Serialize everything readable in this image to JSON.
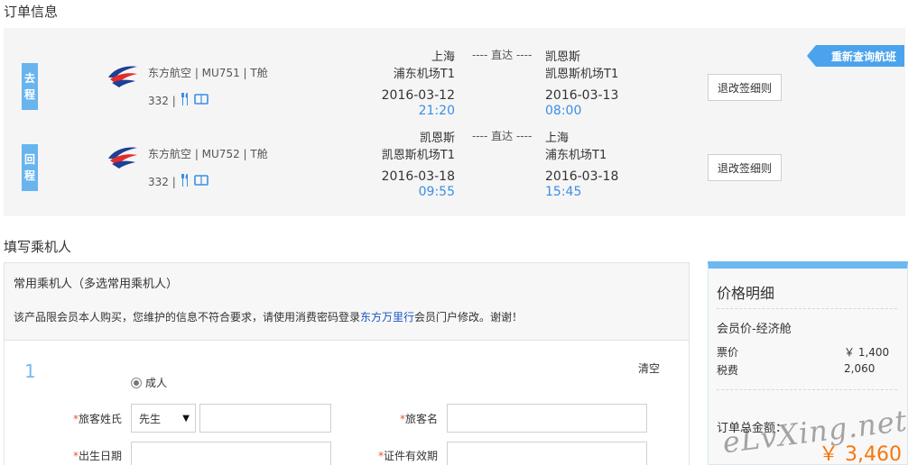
{
  "order_section": {
    "title": "订单信息"
  },
  "requery_label": "重新查询航班",
  "flights": [
    {
      "direction": [
        "去",
        "程"
      ],
      "airline": "东方航空 | MU751 | T舱",
      "aircraft": "332 |",
      "from_city": "上海",
      "from_airport": "浦东机场T1",
      "depart_date": "2016-03-12",
      "depart_time": "21:20",
      "direct": "---- 直达 ----",
      "to_city": "凯恩斯",
      "to_airport": "凯恩斯机场T1",
      "arrive_date": "2016-03-13",
      "arrive_time": "08:00",
      "rule_button": "退改签细则"
    },
    {
      "direction": [
        "回",
        "程"
      ],
      "airline": "东方航空 | MU752 | T舱",
      "aircraft": "332 |",
      "from_city": "凯恩斯",
      "from_airport": "凯恩斯机场T1",
      "depart_date": "2016-03-18",
      "depart_time": "09:55",
      "direct": "---- 直达 ----",
      "to_city": "上海",
      "to_airport": "浦东机场T1",
      "arrive_date": "2016-03-18",
      "arrive_time": "15:45",
      "rule_button": "退改签细则"
    }
  ],
  "passenger_section": {
    "title": "填写乘机人"
  },
  "frequent": {
    "label": "常用乘机人（多选常用乘机人）",
    "notice_prefix": "该产品限会员本人购买，您维护的信息不符合要求，请使用消费密码登录",
    "notice_link": "东方万里行",
    "notice_suffix": "会员门户修改。谢谢！"
  },
  "passenger_form": {
    "index": "1",
    "clear_label": "清空",
    "type_label": "成人",
    "surname_label": "旅客姓氏",
    "title_value": "先生",
    "given_name_label": "旅客名",
    "birth_label": "出生日期",
    "id_expiry_label": "证件有效期",
    "required_mark": "*"
  },
  "price": {
    "title": "价格明细",
    "cabin": "会员价-经济舱",
    "ticket_label": "票价",
    "ticket_value": "￥ 1,400",
    "tax_label": "税费",
    "tax_value": "2,060",
    "total_label": "订单总金额：",
    "total_value": "￥ 3,460"
  },
  "watermark": "eLvXing.net",
  "colors": {
    "accent_blue": "#4aa3ec",
    "badge_blue": "#68b4ef",
    "time_blue": "#3a8ee6",
    "total_orange": "#f5780c",
    "required_red": "#e8562a"
  }
}
